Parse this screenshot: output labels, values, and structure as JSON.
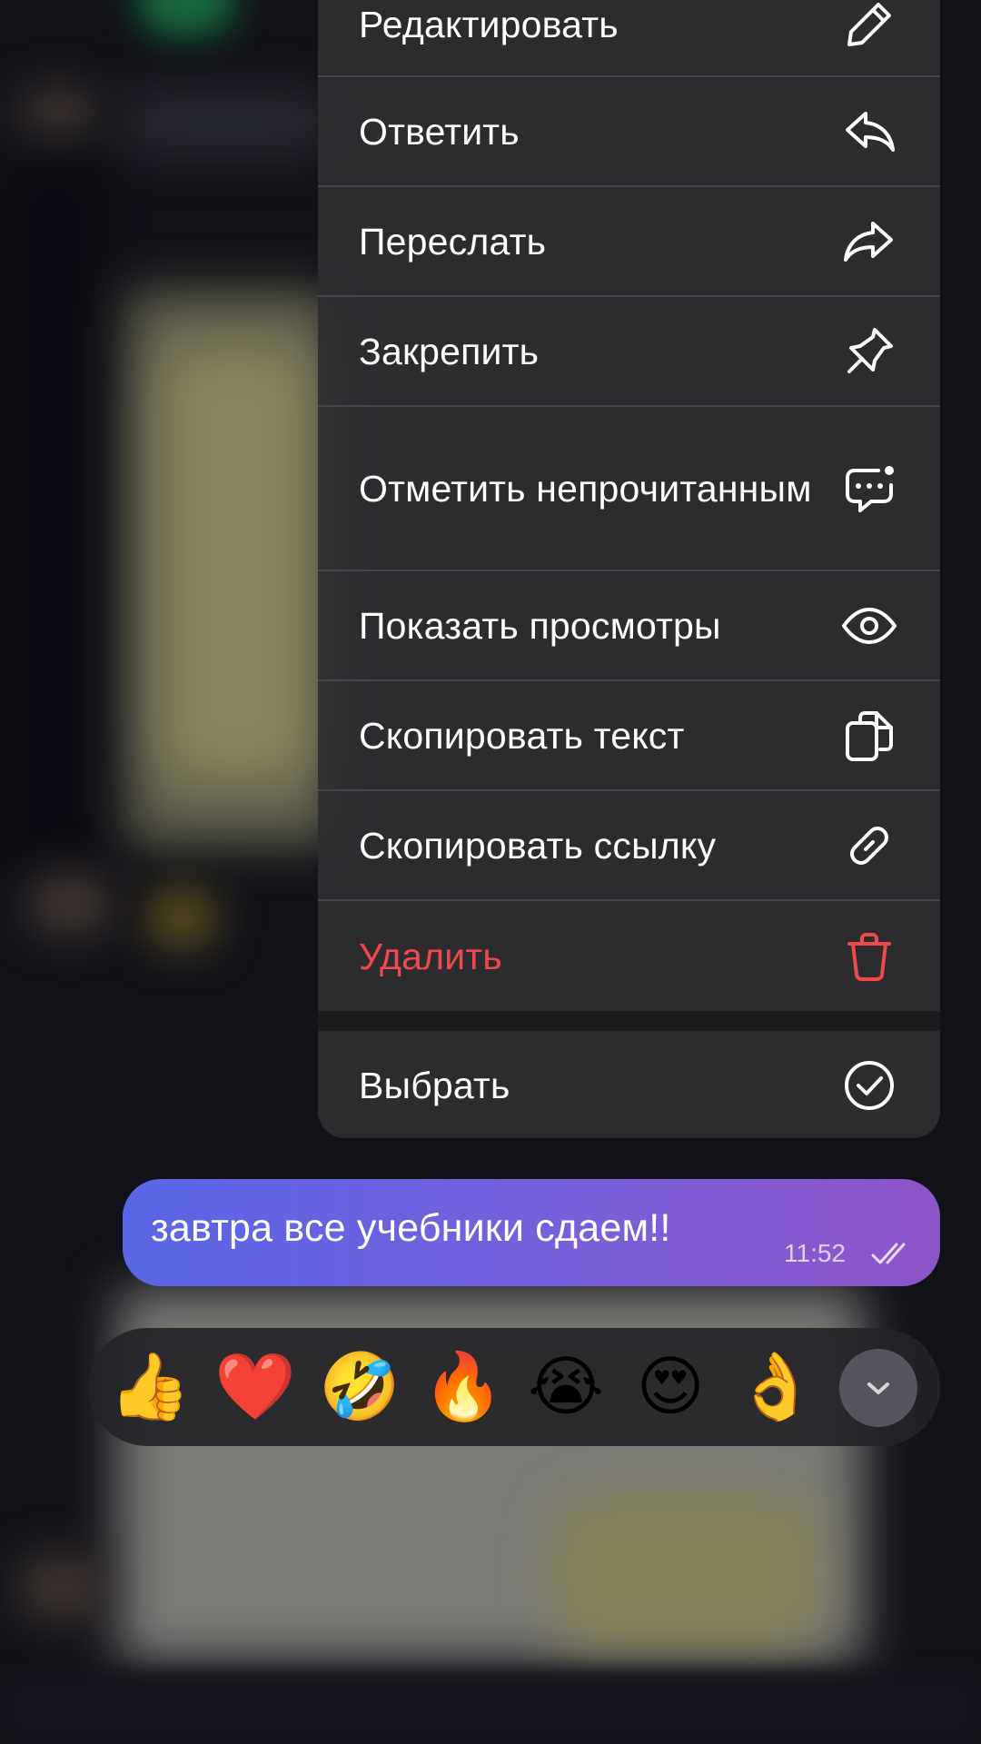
{
  "menu": {
    "items": [
      {
        "label": "Редактировать",
        "icon": "pencil-icon"
      },
      {
        "label": "Ответить",
        "icon": "reply-icon"
      },
      {
        "label": "Переслать",
        "icon": "forward-icon"
      },
      {
        "label": "Закрепить",
        "icon": "pin-icon"
      },
      {
        "label": "Отметить непрочитанным",
        "icon": "unread-chat-icon"
      },
      {
        "label": "Показать просмотры",
        "icon": "eye-icon"
      },
      {
        "label": "Скопировать текст",
        "icon": "copy-icon"
      },
      {
        "label": "Скопировать ссылку",
        "icon": "link-icon"
      },
      {
        "label": "Удалить",
        "icon": "trash-icon",
        "color": "#f0484c"
      }
    ],
    "select": {
      "label": "Выбрать",
      "icon": "check-circle-icon"
    }
  },
  "message": {
    "text": "завтра все учебники сдаем!!",
    "time": "11:52",
    "status_icon": "double-check-icon",
    "bubble_colors": [
      "#5a66e6",
      "#8d55c9"
    ]
  },
  "reactions": {
    "items": [
      "👍",
      "❤️",
      "🤣",
      "🔥",
      "😭",
      "😍",
      "👌"
    ],
    "more_icon": "chevron-down-icon"
  }
}
